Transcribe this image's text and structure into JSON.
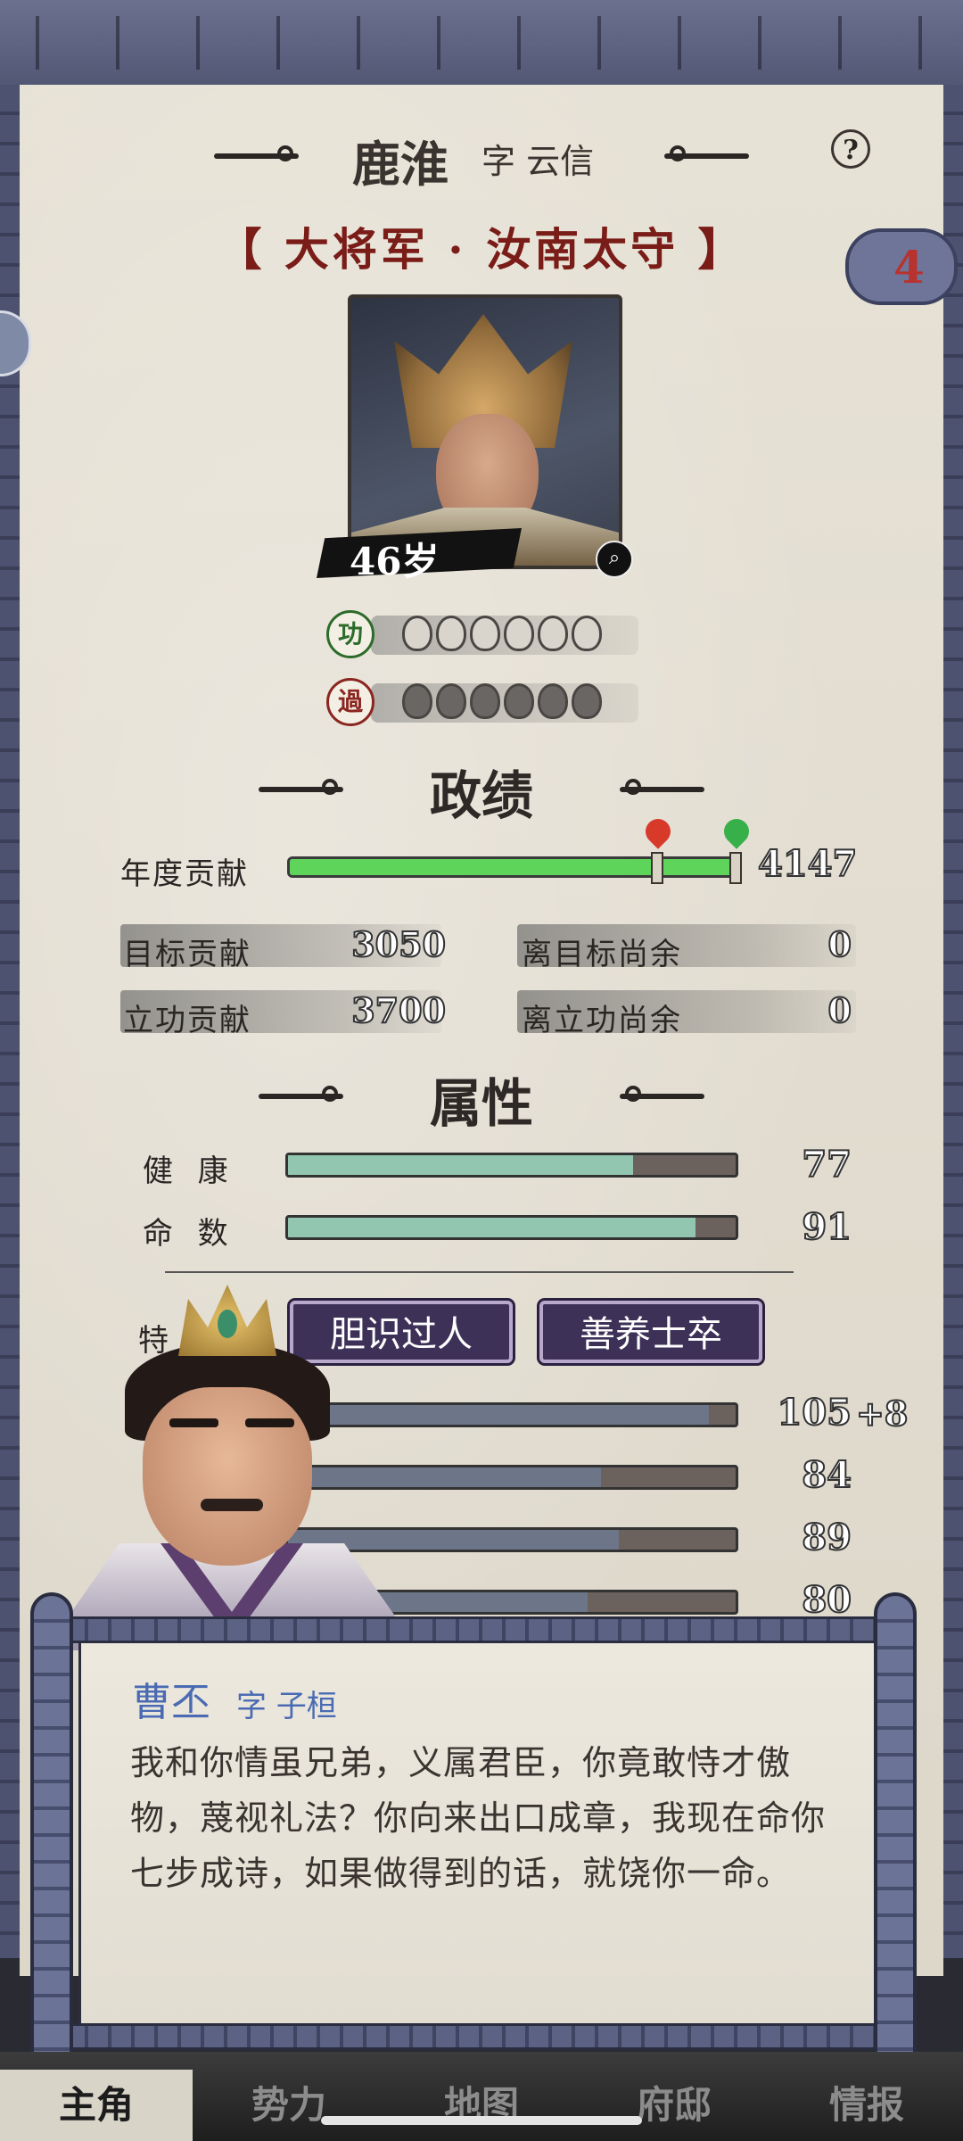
{
  "character": {
    "name": "鹿淮",
    "courtesy": "字 云信",
    "title": "【 大将军 · 汝南太守 】",
    "age": "46岁"
  },
  "badge": {
    "count": "4"
  },
  "merit": {
    "gong_label": "功",
    "guo_label": "過",
    "gong_tokens": 6,
    "guo_tokens": 6
  },
  "performance": {
    "section_title": "政绩",
    "annual_label": "年度贡献",
    "annual_value": "4147",
    "annual_progress": 1.0,
    "target_label": "目标贡献",
    "target_value": "3050",
    "distance_target_label": "离目标尚余",
    "distance_target_value": "0",
    "merit_label": "立功贡献",
    "merit_value": "3700",
    "distance_merit_label": "离立功尚余",
    "distance_merit_value": "0"
  },
  "attributes": {
    "section_title": "属性",
    "items": [
      {
        "label": "健  康",
        "value": "77",
        "level": 0.77
      },
      {
        "label": "命  数",
        "value": "91",
        "level": 0.91
      }
    ]
  },
  "traits": {
    "label_partial": "特",
    "items": [
      "胆识过人",
      "善养士卒"
    ]
  },
  "stats": [
    {
      "value": "105",
      "bonus": "+8",
      "level": 0.94
    },
    {
      "value": "84",
      "level": 0.7
    },
    {
      "value": "89",
      "level": 0.74
    },
    {
      "value": "80",
      "level": 0.67
    }
  ],
  "dialog": {
    "speaker": "曹丕",
    "speaker_courtesy": "字 子桓",
    "text": "我和你情虽兄弟，义属君臣，你竟敢恃才傲物，蔑视礼法？你向来出口成章，我现在命你七步成诗，如果做得到的话，就饶你一命。"
  },
  "nav": {
    "items": [
      "主角",
      "势力",
      "地图",
      "府邸",
      "情报"
    ],
    "active": 0
  },
  "colors": {
    "annual_bar": "#5fd45b",
    "attr_bar": "#93c6b0",
    "title_red": "#7a1c17",
    "trait_bg": "#3d3158",
    "speaker_blue": "#4a6bb3"
  }
}
